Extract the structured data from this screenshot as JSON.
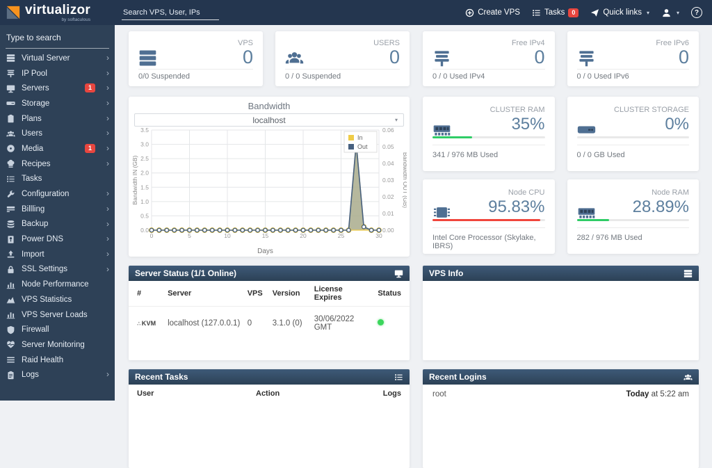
{
  "topbar": {
    "logo_text": "virtualizor",
    "logo_subtext": "by softaculous",
    "search_placeholder": "Search VPS, User, IPs",
    "create_vps_label": "Create VPS",
    "tasks_label": "Tasks",
    "tasks_count": "0",
    "quick_links_label": "Quick links",
    "help_label": "?"
  },
  "sidebar": {
    "search_placeholder": "Type to search",
    "items": [
      {
        "label": "Virtual Server",
        "icon": "server-stack",
        "chevron": true
      },
      {
        "label": "IP Pool",
        "icon": "ip-pool",
        "chevron": true
      },
      {
        "label": "Servers",
        "icon": "monitor",
        "chevron": true,
        "badge": "1"
      },
      {
        "label": "Storage",
        "icon": "drive",
        "chevron": true
      },
      {
        "label": "Plans",
        "icon": "clipboard",
        "chevron": true
      },
      {
        "label": "Users",
        "icon": "users",
        "chevron": true
      },
      {
        "label": "Media",
        "icon": "disc",
        "chevron": true,
        "badge": "1"
      },
      {
        "label": "Recipes",
        "icon": "chef-hat",
        "chevron": true
      },
      {
        "label": "Tasks",
        "icon": "task-list",
        "chevron": false
      },
      {
        "label": "Configuration",
        "icon": "wrench",
        "chevron": true
      },
      {
        "label": "Billling",
        "icon": "billing",
        "chevron": true
      },
      {
        "label": "Backup",
        "icon": "database",
        "chevron": true
      },
      {
        "label": "Power DNS",
        "icon": "dns-doc",
        "chevron": true
      },
      {
        "label": "Import",
        "icon": "upload",
        "chevron": true
      },
      {
        "label": "SSL Settings",
        "icon": "lock",
        "chevron": true
      },
      {
        "label": "Node Performance",
        "icon": "bar-chart",
        "chevron": false
      },
      {
        "label": "VPS Statistics",
        "icon": "area-chart",
        "chevron": false
      },
      {
        "label": "VPS Server Loads",
        "icon": "bar-chart",
        "chevron": false
      },
      {
        "label": "Firewall",
        "icon": "shield",
        "chevron": false
      },
      {
        "label": "Server Monitoring",
        "icon": "heart-pulse",
        "chevron": false
      },
      {
        "label": "Raid Health",
        "icon": "raid-lines",
        "chevron": false
      },
      {
        "label": "Logs",
        "icon": "logs-clipboard",
        "chevron": true
      }
    ]
  },
  "stat_cards": [
    {
      "title": "VPS",
      "value": "0",
      "footer": "0/0 Suspended",
      "icon": "server-stack"
    },
    {
      "title": "USERS",
      "value": "0",
      "footer": "0 / 0 Suspended",
      "icon": "users"
    },
    {
      "title": "Free IPv4",
      "value": "0",
      "footer": "0 / 0 Used IPv4",
      "icon": "ip-pool"
    },
    {
      "title": "Free IPv6",
      "value": "0",
      "footer": "0 / 0 Used IPv6",
      "icon": "ip-pool"
    }
  ],
  "gauge_cards": [
    {
      "title": "CLUSTER RAM",
      "value": "35%",
      "footer": "341 / 976 MB Used",
      "icon": "ram",
      "bar_percent": 35,
      "bar_color": "#2fcc66"
    },
    {
      "title": "CLUSTER STORAGE",
      "value": "0%",
      "footer": "0 / 0 GB Used",
      "icon": "drive",
      "bar_percent": 0,
      "bar_color": "#2fcc66"
    },
    {
      "title": "Node CPU",
      "value": "95.83%",
      "footer": "Intel Core Processor (Skylake, IBRS)",
      "icon": "cpu",
      "bar_percent": 96,
      "bar_color": "#f0453c"
    },
    {
      "title": "Node RAM",
      "value": "28.89%",
      "footer": "282 / 976 MB Used",
      "icon": "ram",
      "bar_percent": 29,
      "bar_color": "#2fcc66"
    }
  ],
  "bandwidth": {
    "title": "Bandwidth",
    "selected_server": "localhost"
  },
  "chart_data": {
    "type": "line",
    "title": "Bandwidth",
    "xlabel": "Days",
    "ylabel_left": "Bandwidth IN (GB)",
    "ylabel_right": "Bandwidth OUT (GB)",
    "x": [
      0,
      1,
      2,
      3,
      4,
      5,
      6,
      7,
      8,
      9,
      10,
      11,
      12,
      13,
      14,
      15,
      16,
      17,
      18,
      19,
      20,
      21,
      22,
      23,
      24,
      25,
      26,
      27,
      28,
      29,
      30
    ],
    "x_ticks": [
      0,
      5,
      10,
      15,
      20,
      25,
      30
    ],
    "ylim_left": [
      0,
      3.5
    ],
    "ylim_right": [
      0,
      0.06
    ],
    "left_ticks": [
      "0.0",
      "0.5",
      "1.0",
      "1.5",
      "2.0",
      "2.5",
      "3.0",
      "3.5"
    ],
    "right_ticks": [
      "0.00",
      "0.01",
      "0.02",
      "0.03",
      "0.04",
      "0.05",
      "0.06"
    ],
    "legend_position": "top-right",
    "fill_color": "#a9ac8c",
    "series": [
      {
        "name": "In",
        "axis": "left",
        "color": "#efcc48",
        "values": [
          0,
          0,
          0,
          0,
          0,
          0,
          0,
          0,
          0,
          0,
          0,
          0,
          0,
          0,
          0,
          0,
          0,
          0,
          0,
          0,
          0,
          0,
          0,
          0,
          0,
          0,
          0,
          3.1,
          0.12,
          0,
          0
        ]
      },
      {
        "name": "Out",
        "axis": "right",
        "color": "#47607f",
        "values": [
          0,
          0,
          0,
          0,
          0,
          0,
          0,
          0,
          0,
          0,
          0,
          0,
          0,
          0,
          0,
          0,
          0,
          0,
          0,
          0,
          0,
          0,
          0,
          0,
          0,
          0,
          0,
          0.052,
          0.002,
          0,
          0
        ]
      }
    ]
  },
  "server_status": {
    "title": "Server Status (1/1 Online)",
    "icon": "monitor",
    "columns": [
      "#",
      "Server",
      "VPS",
      "Version",
      "License Expires",
      "Status"
    ],
    "rows": [
      {
        "type": "KVM",
        "server": "localhost (127.0.0.1)",
        "vps": "0",
        "version": "3.1.0 (0)",
        "license_expires": "30/06/2022 GMT",
        "status": "online"
      }
    ]
  },
  "vps_info": {
    "title": "VPS Info",
    "icon": "server-stack"
  },
  "recent_tasks": {
    "title": "Recent Tasks",
    "icon": "task-list",
    "columns": [
      "User",
      "Action",
      "Logs"
    ]
  },
  "recent_logins": {
    "title": "Recent Logins",
    "icon": "users",
    "rows": [
      {
        "user": "root",
        "time_bold": "Today",
        "time_rest": " at 5:22 am"
      }
    ]
  }
}
